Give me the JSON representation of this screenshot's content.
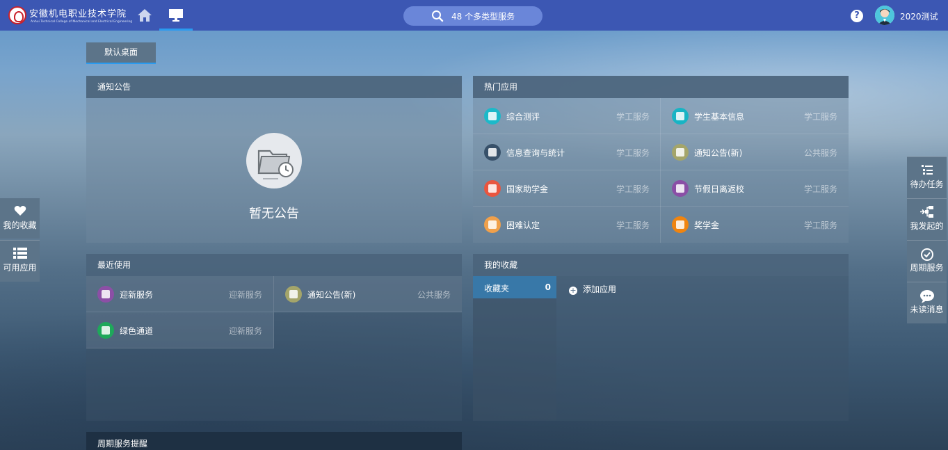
{
  "header": {
    "school_name_cn": "安徽机电职业技术学院",
    "school_name_en": "Anhui Technical College of Mechanical and Electrical Engineering",
    "search_text": "48 个多类型服务",
    "help_label": "?",
    "user_name": "2020测试"
  },
  "tabs": {
    "desktop_tab": "默认桌面"
  },
  "notice": {
    "title": "通知公告",
    "empty_text": "暂无公告"
  },
  "hot_apps": {
    "title": "热门应用",
    "items": [
      {
        "name": "综合测评",
        "category": "学工服务"
      },
      {
        "name": "学生基本信息",
        "category": "学工服务"
      },
      {
        "name": "信息查询与统计",
        "category": "学工服务"
      },
      {
        "name": "通知公告(新)",
        "category": "公共服务"
      },
      {
        "name": "国家助学金",
        "category": "学工服务"
      },
      {
        "name": "节假日离返校",
        "category": "学工服务"
      },
      {
        "name": "困难认定",
        "category": "学工服务"
      },
      {
        "name": "奖学金",
        "category": "学工服务"
      }
    ]
  },
  "recent": {
    "title": "最近使用",
    "items": [
      {
        "name": "迎新服务",
        "category": "迎新服务"
      },
      {
        "name": "通知公告(新)",
        "category": "公共服务"
      },
      {
        "name": "绿色通道",
        "category": "迎新服务"
      }
    ]
  },
  "favorites": {
    "title": "我的收藏",
    "folder_label": "收藏夹",
    "folder_count": "0",
    "add_label": "添加应用",
    "add_icon": "+"
  },
  "periodic": {
    "title": "周期服务提醒"
  },
  "left_sidebar": [
    {
      "label": "我的收藏",
      "icon": "heart-icon"
    },
    {
      "label": "可用应用",
      "icon": "list-icon"
    }
  ],
  "right_sidebar": [
    {
      "label": "待办任务",
      "icon": "tasks-icon"
    },
    {
      "label": "我发起的",
      "icon": "flow-icon"
    },
    {
      "label": "周期服务",
      "icon": "cycle-check-icon"
    },
    {
      "label": "未读消息",
      "icon": "chat-icon"
    }
  ],
  "colors": {
    "topbar": "#3c57b3",
    "accent": "#2a9bf0",
    "sidebar": "#5c7489"
  }
}
